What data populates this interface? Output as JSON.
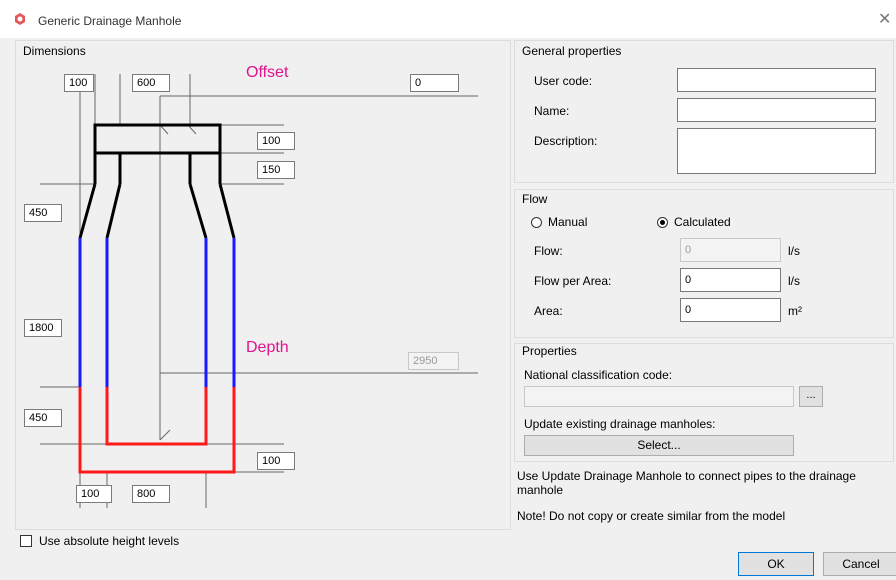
{
  "window": {
    "title": "Generic Drainage Manhole",
    "close_icon": "close-icon",
    "app_icon": "app-logo-icon"
  },
  "dimensions": {
    "label": "Dimensions",
    "offset_label": "Offset",
    "depth_label": "Depth",
    "top_left_width": "100",
    "top_inner_width": "600",
    "offset_value": "0",
    "cover_thickness": "100",
    "frame_height": "150",
    "cone_height": "450",
    "shaft_height": "1800",
    "depth_value": "2950",
    "base_height": "450",
    "base_thickness": "100",
    "bottom_wall": "100",
    "bottom_inner": "800",
    "colors": {
      "wall_upper": "#1a1aff",
      "wall_lower": "#ff1a1a",
      "label_pink": "#e0128e"
    }
  },
  "general": {
    "label": "General properties",
    "user_code_label": "User code:",
    "user_code": "",
    "name_label": "Name:",
    "name": "",
    "description_label": "Description:",
    "description": ""
  },
  "flow": {
    "label": "Flow",
    "manual_label": "Manual",
    "calculated_label": "Calculated",
    "selected": "Calculated",
    "flow_label": "Flow:",
    "flow_value": "0",
    "flow_unit": "l/s",
    "flow_per_area_label": "Flow per Area:",
    "flow_per_area_value": "0",
    "flow_per_area_unit": "l/s",
    "area_label": "Area:",
    "area_value": "0",
    "area_unit": "m²"
  },
  "properties": {
    "label": "Properties",
    "national_code_label": "National classification code:",
    "national_code": "",
    "browse_label": "...",
    "update_label": "Update existing drainage manholes:",
    "select_label": "Select..."
  },
  "notes": {
    "update_note": "Use Update Drainage Manhole to connect pipes to the drainage manhole",
    "copy_note": "Note! Do not copy or create similar from the model"
  },
  "footer": {
    "absolute_levels_label": "Use absolute height levels",
    "ok_label": "OK",
    "cancel_label": "Cancel"
  }
}
